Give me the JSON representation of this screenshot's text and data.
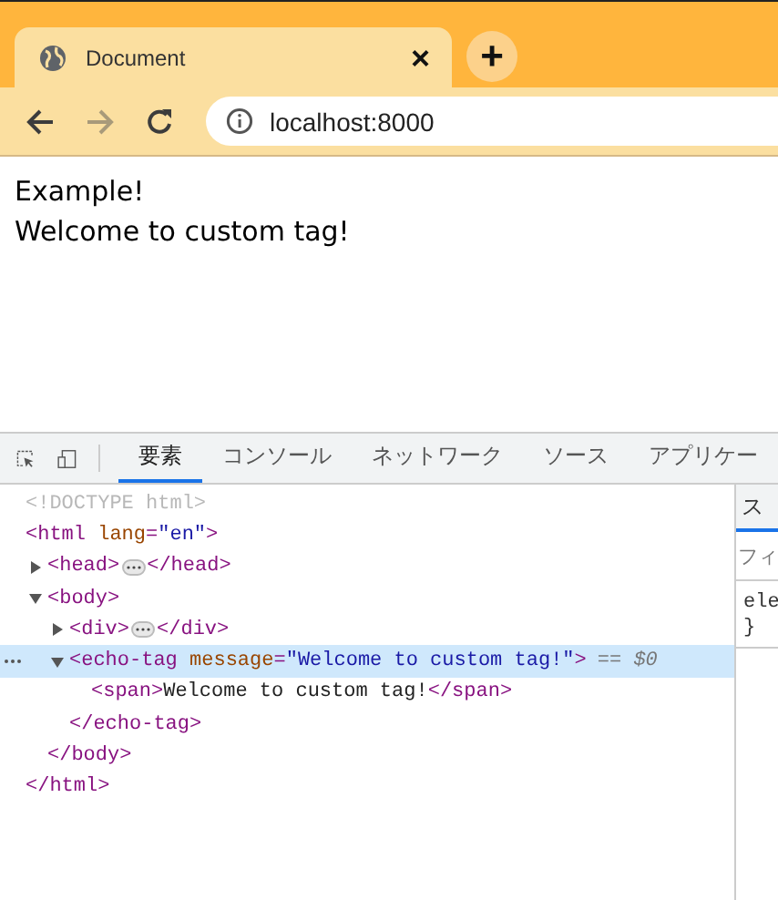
{
  "browser_tab": {
    "title": "Document",
    "close": "×",
    "new_tab": "+"
  },
  "address_bar": {
    "url": "localhost:8000"
  },
  "page": {
    "lines": [
      "Example!",
      "Welcome to custom tag!"
    ]
  },
  "devtools": {
    "tabs": [
      {
        "label": "要素",
        "selected": true
      },
      {
        "label": "コンソール",
        "selected": false
      },
      {
        "label": "ネットワーク",
        "selected": false
      },
      {
        "label": "ソース",
        "selected": false
      },
      {
        "label": "アプリケー",
        "selected": false
      }
    ],
    "tree": [
      {
        "kind": "doctype",
        "text": "<!DOCTYPE html>"
      },
      {
        "kind": "element",
        "selected": false,
        "open": [
          {
            "kind": "tag",
            "text": "<html "
          },
          {
            "kind": "attr_name",
            "text": "lang"
          },
          {
            "kind": "tag",
            "text": "="
          },
          {
            "kind": "attr_value",
            "text": "\"en\""
          },
          {
            "kind": "tag",
            "text": ">"
          }
        ],
        "close": "</html>",
        "children": [
          {
            "kind": "element",
            "selected": false,
            "expanded": false,
            "open": [
              {
                "kind": "tag",
                "text": "<head>"
              }
            ],
            "close": "</head>"
          },
          {
            "kind": "element",
            "selected": false,
            "expanded": true,
            "open": [
              {
                "kind": "tag",
                "text": "<body>"
              }
            ],
            "close": "</body>",
            "children": [
              {
                "kind": "element",
                "selected": false,
                "expanded": false,
                "open": [
                  {
                    "kind": "tag",
                    "text": "<div>"
                  }
                ],
                "close": "</div>"
              },
              {
                "kind": "element",
                "selected": true,
                "expanded": true,
                "marker": "== $0",
                "open": [
                  {
                    "kind": "tag",
                    "text": "<echo-tag "
                  },
                  {
                    "kind": "attr_name",
                    "text": "message"
                  },
                  {
                    "kind": "tag",
                    "text": "="
                  },
                  {
                    "kind": "attr_value",
                    "text": "\"Welcome to custom tag!\""
                  },
                  {
                    "kind": "tag",
                    "text": ">"
                  }
                ],
                "close": "</echo-tag>",
                "children": [
                  {
                    "kind": "inline",
                    "open": "<span>",
                    "text": "Welcome to custom tag!",
                    "close": "</span>"
                  }
                ]
              }
            ]
          }
        ]
      }
    ],
    "side_panel": {
      "tab": "ス",
      "filter": "フィ",
      "rule_lines": [
        "ele",
        "}"
      ]
    }
  }
}
